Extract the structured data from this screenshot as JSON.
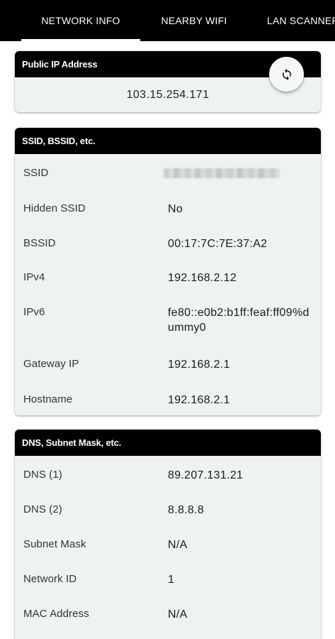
{
  "tabs": [
    {
      "label": "NETWORK INFO",
      "selected": true
    },
    {
      "label": "NEARBY WIFI",
      "selected": false
    },
    {
      "label": "LAN SCANNER",
      "selected": false
    }
  ],
  "public_ip_card": {
    "title": "Public IP Address",
    "ip": "103.15.254.171",
    "refresh_icon": "refresh-icon"
  },
  "ssid_card": {
    "title": "SSID, BSSID, etc.",
    "rows": [
      {
        "label": "SSID",
        "value": "",
        "blurred": true
      },
      {
        "label": "Hidden SSID",
        "value": "No"
      },
      {
        "label": "BSSID",
        "value": "00:17:7C:7E:37:A2"
      },
      {
        "label": "IPv4",
        "value": "192.168.2.12"
      },
      {
        "label": "IPv6",
        "value": "fe80::e0b2:b1ff:feaf:ff09%dummy0"
      },
      {
        "label": "Gateway IP",
        "value": "192.168.2.1"
      },
      {
        "label": "Hostname",
        "value": "192.168.2.1"
      }
    ]
  },
  "dns_card": {
    "title": "DNS, Subnet Mask, etc.",
    "rows": [
      {
        "label": "DNS (1)",
        "value": "89.207.131.21"
      },
      {
        "label": "DNS (2)",
        "value": "8.8.8.8"
      },
      {
        "label": "Subnet Mask",
        "value": "N/A"
      },
      {
        "label": "Network ID",
        "value": "1"
      },
      {
        "label": "MAC Address",
        "value": "N/A"
      }
    ]
  },
  "colors": {
    "header_bg": "#000000",
    "card_bg": "#eef3f0",
    "text": "#1a1a1a"
  }
}
